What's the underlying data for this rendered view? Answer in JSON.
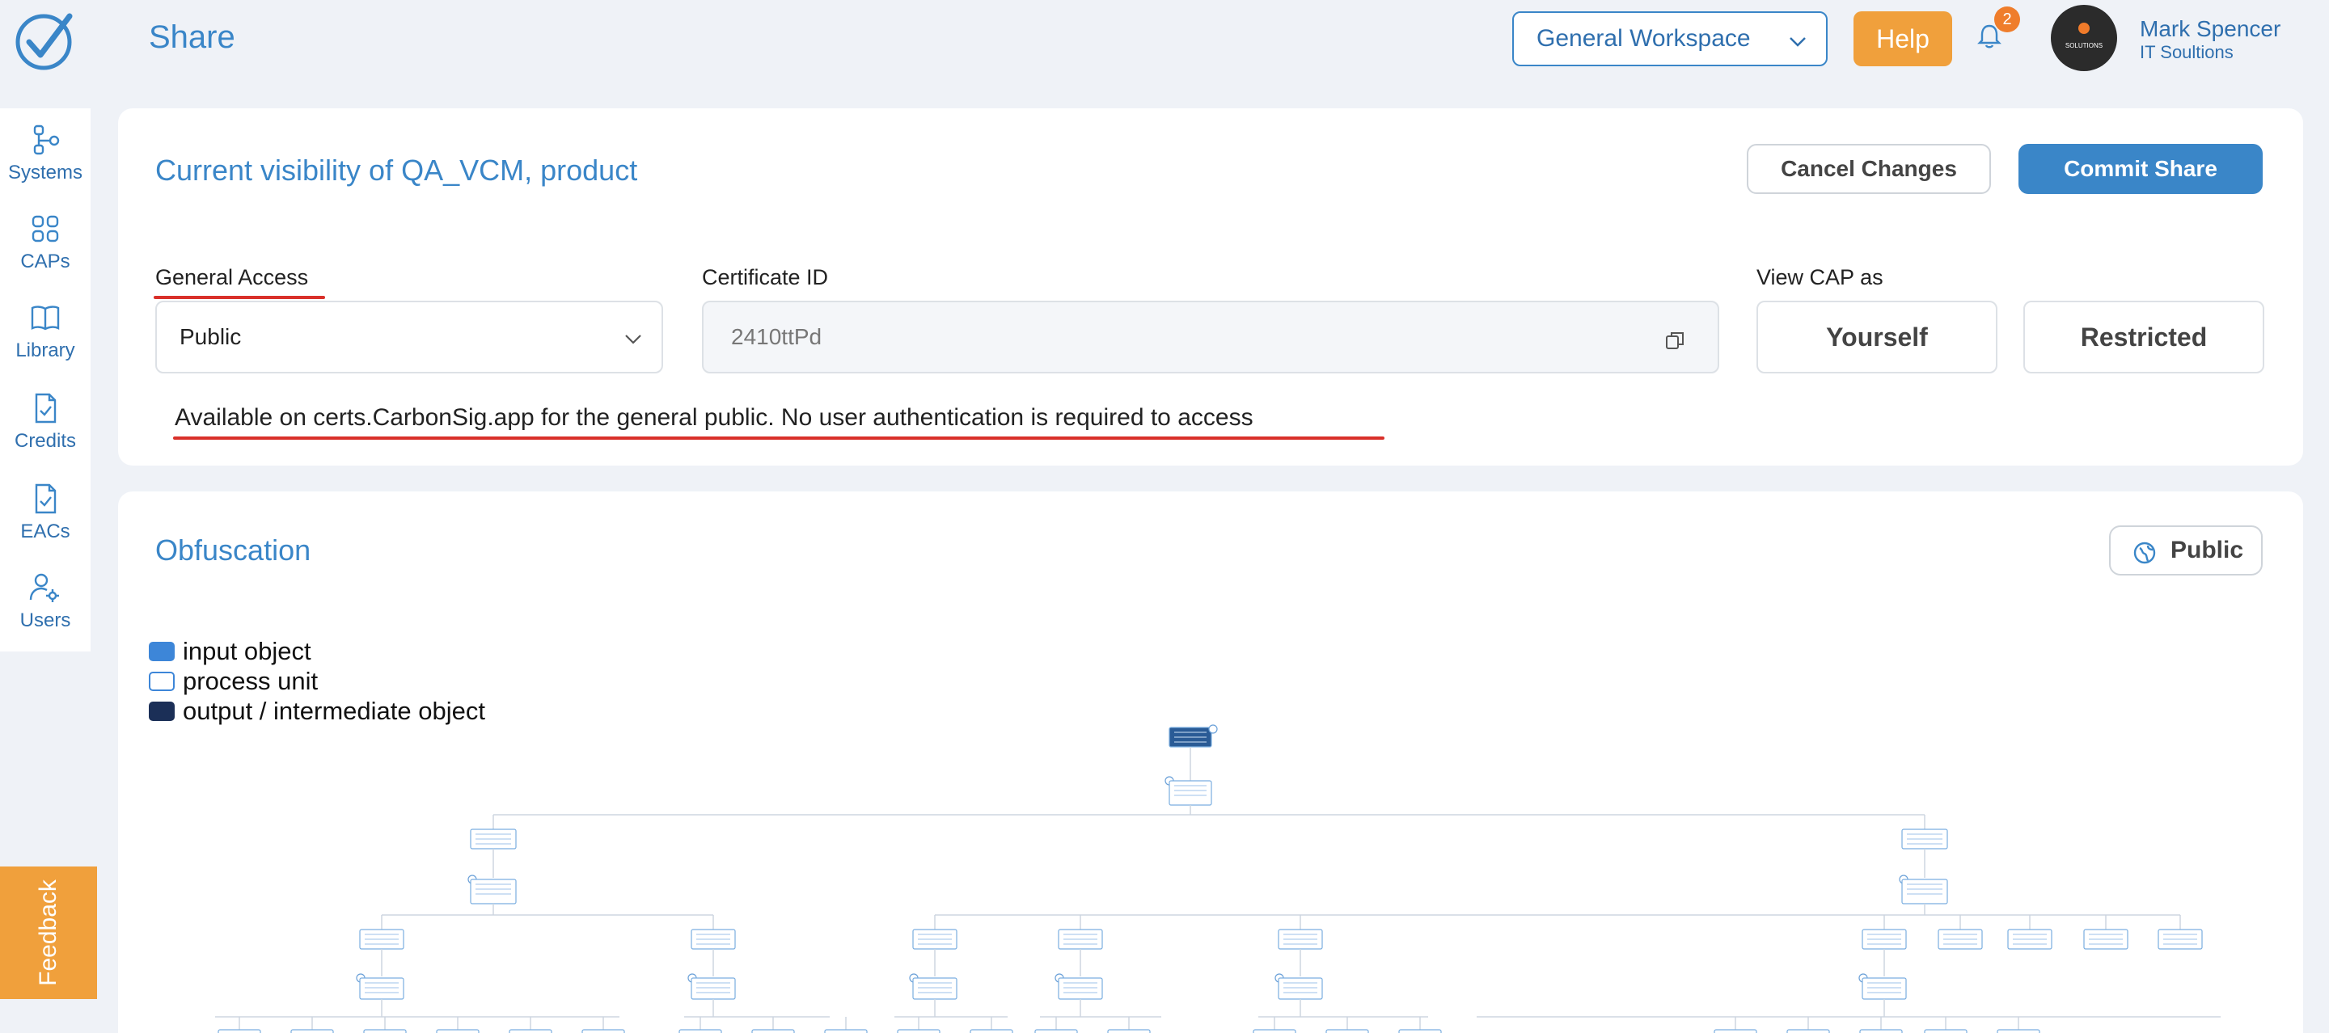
{
  "header": {
    "page_title": "Share",
    "workspace": "General Workspace",
    "help_label": "Help",
    "notification_count": "2",
    "user_name": "Mark Spencer",
    "user_org": "IT Soultions",
    "avatar_text": "SOLUTIONS"
  },
  "sidebar": {
    "items": [
      {
        "label": "Systems",
        "icon": "systems-icon"
      },
      {
        "label": "CAPs",
        "icon": "grid-icon"
      },
      {
        "label": "Library",
        "icon": "book-icon"
      },
      {
        "label": "Credits",
        "icon": "file-check-icon"
      },
      {
        "label": "EACs",
        "icon": "file-check-icon"
      },
      {
        "label": "Users",
        "icon": "users-gear-icon"
      }
    ]
  },
  "feedback_label": "Feedback",
  "visibility": {
    "title": "Current visibility of QA_VCM, product",
    "cancel_label": "Cancel Changes",
    "commit_label": "Commit Share",
    "general_access_label": "General Access",
    "general_access_value": "Public",
    "certificate_label": "Certificate ID",
    "certificate_value": "2410ttPd",
    "view_cap_label": "View CAP as",
    "view_options": [
      "Yourself",
      "Restricted"
    ],
    "access_note": "Available on certs.CarbonSig.app for the general public. No user authentication is required to access"
  },
  "obfuscation": {
    "title": "Obfuscation",
    "public_label": "Public",
    "legend": [
      {
        "label": "input object",
        "color": "#3d86d8",
        "style": "filled"
      },
      {
        "label": "process unit",
        "color": "#ffffff",
        "style": "outline"
      },
      {
        "label": "output / intermediate object",
        "color": "#1b2f57",
        "style": "filled"
      }
    ]
  },
  "colors": {
    "accent": "#3a86c8",
    "orange": "#f0a03c",
    "underline": "#d9302a",
    "dark_node": "#1b2f57"
  }
}
